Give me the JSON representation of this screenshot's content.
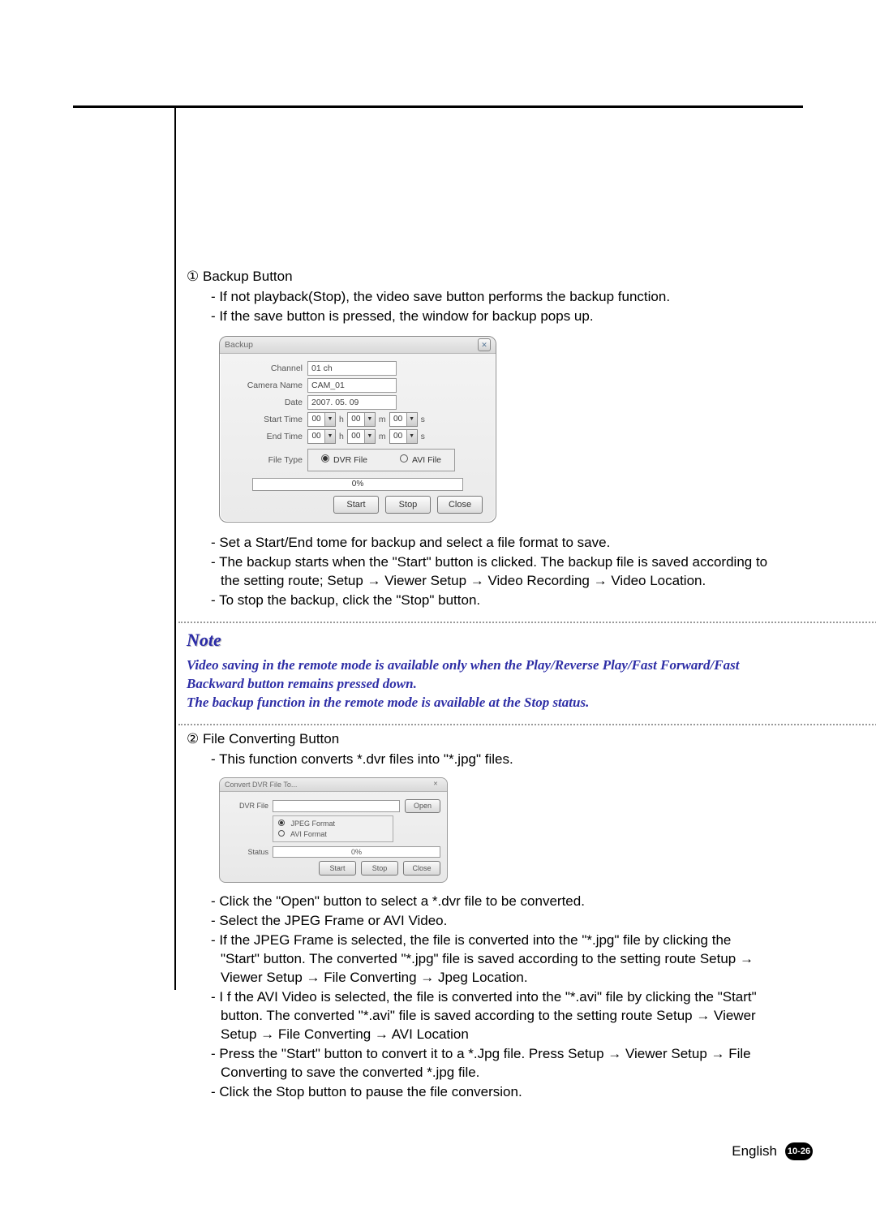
{
  "section1": {
    "num": "①",
    "title": "Backup Button",
    "items_a": [
      "If not playback(Stop), the video save button performs the backup function.",
      "If the save button is pressed, the window for backup pops up."
    ],
    "items_b": [
      "Set a Start/End tome for backup and select a file format to save.",
      "The backup starts when the \"Start\" button is clicked. The backup file is saved according to the setting route; Setup → Viewer Setup → Video Recording → Video Location.",
      "To stop the backup, click the \"Stop\" button."
    ]
  },
  "backup_dialog": {
    "title": "Backup",
    "labels": {
      "channel": "Channel",
      "camera_name": "Camera Name",
      "date": "Date",
      "start_time": "Start Time",
      "end_time": "End Time",
      "file_type": "File Type"
    },
    "values": {
      "channel": "01 ch",
      "camera_name": "CAM_01",
      "date": "2007. 05. 09",
      "start": {
        "h": "00",
        "m": "00",
        "s": "00"
      },
      "end": {
        "h": "00",
        "m": "00",
        "s": "00"
      }
    },
    "units": {
      "h": "h",
      "m": "m",
      "s": "s"
    },
    "file_types": {
      "dvr": "DVR File",
      "avi": "AVI File"
    },
    "progress": "0%",
    "buttons": {
      "start": "Start",
      "stop": "Stop",
      "close": "Close"
    }
  },
  "note": {
    "heading": "Note",
    "body": "Video saving in the remote mode is available only when the Play/Reverse Play/Fast Forward/Fast Backward button remains pressed down.\nThe backup function in the remote mode is available at the Stop status."
  },
  "section2": {
    "num": "②",
    "title": "File Converting Button",
    "items_a": [
      "This function converts *.dvr files into  \"*.jpg\" files."
    ],
    "items_b": [
      "Click the \"Open\" button to select a *.dvr file to be converted.",
      "Select the JPEG Frame or AVI Video.",
      "If the JPEG Frame is selected, the file is converted into the \"*.jpg\" file by clicking the \"Start\" button. The converted \"*.jpg\" file is saved according to the setting route Setup  → Viewer Setup → File Converting → Jpeg Location.",
      "I f the AVI Video is selected, the file is converted into the \"*.avi\" file by clicking the \"Start\" button. The converted \"*.avi\" file is saved according to the setting route Setup → Viewer Setup → File Converting  → AVI Location",
      "Press the \"Start\" button to convert it to a *.Jpg file. Press Setup  → Viewer Setup → File Converting to save the converted *.jpg file.",
      "Click the Stop button to pause the file conversion."
    ]
  },
  "convert_dialog": {
    "title": "Convert DVR File To...",
    "labels": {
      "dvr_file": "DVR File",
      "status": "Status"
    },
    "open": "Open",
    "formats": {
      "jpeg": "JPEG Format",
      "avi": "AVI Format"
    },
    "progress": "0%",
    "buttons": {
      "start": "Start",
      "stop": "Stop",
      "close": "Close"
    }
  },
  "footer": {
    "lang": "English",
    "page": "10-26"
  }
}
